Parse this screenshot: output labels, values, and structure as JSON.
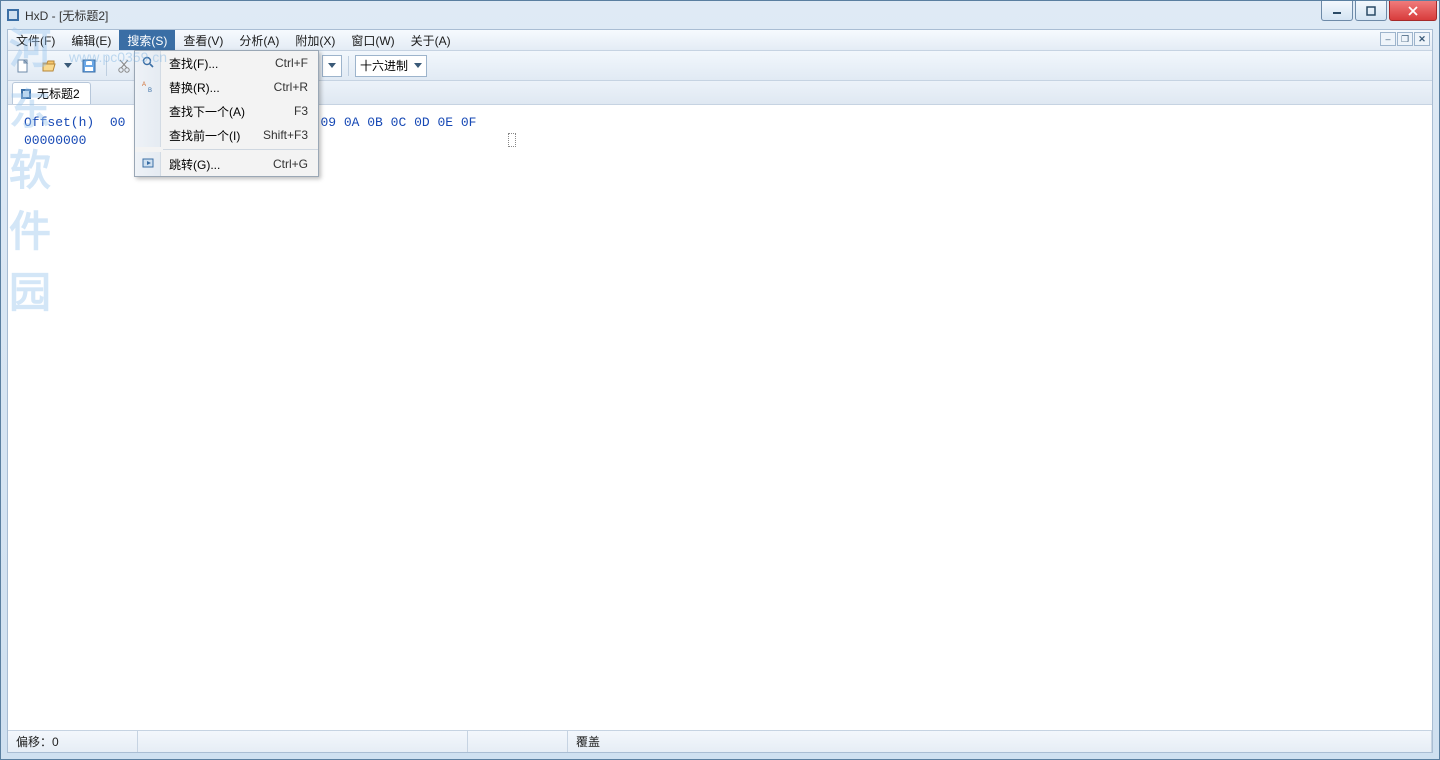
{
  "window": {
    "title": "HxD - [无标题2]"
  },
  "watermark": {
    "big": "河东软件园",
    "url": "www.pc0359.cn"
  },
  "menubar": {
    "items": [
      "文件(F)",
      "编辑(E)",
      "搜索(S)",
      "查看(V)",
      "分析(A)",
      "附加(X)",
      "窗口(W)",
      "关于(A)"
    ],
    "active_index": 2
  },
  "toolbar": {
    "encoding_select": "十六进制"
  },
  "tab": {
    "label": "无标题2"
  },
  "hex": {
    "header": "Offset(h)  00 01 02 03 04 05 06 07 08 09 0A 0B 0C 0D 0E 0F",
    "addr0": "00000000"
  },
  "search_menu": {
    "items": [
      {
        "icon": "search",
        "label": "查找(F)...",
        "shortcut": "Ctrl+F"
      },
      {
        "icon": "replace",
        "label": "替换(R)...",
        "shortcut": "Ctrl+R"
      },
      {
        "icon": "",
        "label": "查找下一个(A)",
        "shortcut": "F3"
      },
      {
        "icon": "",
        "label": "查找前一个(I)",
        "shortcut": "Shift+F3"
      },
      {
        "sep": true
      },
      {
        "icon": "goto",
        "label": "跳转(G)...",
        "shortcut": "Ctrl+G"
      }
    ]
  },
  "status": {
    "offset": "偏移：0",
    "mode": "覆盖"
  }
}
